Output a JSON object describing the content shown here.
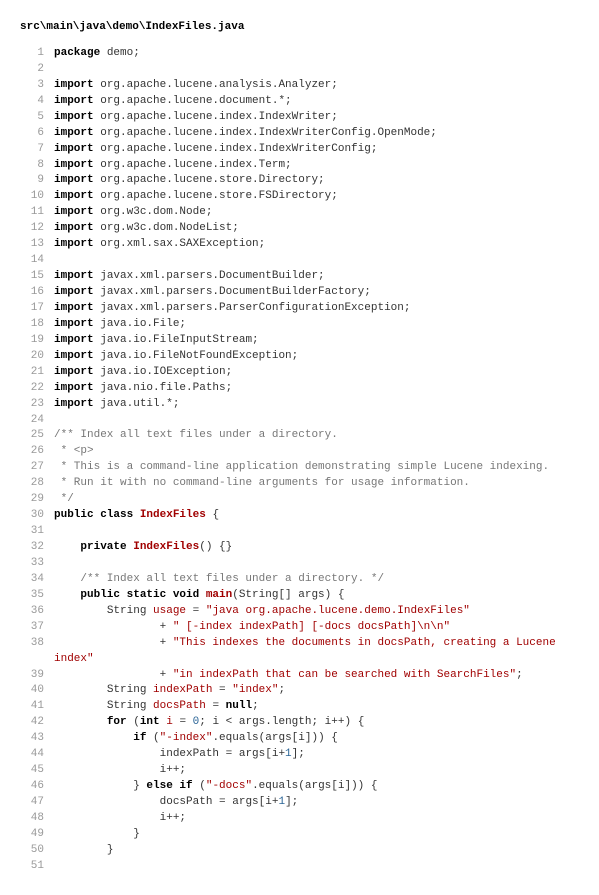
{
  "file_path": "src\\main\\java\\demo\\IndexFiles.java",
  "lines": [
    {
      "n": 1,
      "tokens": [
        {
          "t": "package ",
          "c": "kw"
        },
        {
          "t": "demo;",
          "c": ""
        }
      ]
    },
    {
      "n": 2,
      "tokens": []
    },
    {
      "n": 3,
      "tokens": [
        {
          "t": "import ",
          "c": "kw"
        },
        {
          "t": "org.apache.lucene.analysis.Analyzer;",
          "c": ""
        }
      ]
    },
    {
      "n": 4,
      "tokens": [
        {
          "t": "import ",
          "c": "kw"
        },
        {
          "t": "org.apache.lucene.document.*;",
          "c": ""
        }
      ]
    },
    {
      "n": 5,
      "tokens": [
        {
          "t": "import ",
          "c": "kw"
        },
        {
          "t": "org.apache.lucene.index.IndexWriter;",
          "c": ""
        }
      ]
    },
    {
      "n": 6,
      "tokens": [
        {
          "t": "import ",
          "c": "kw"
        },
        {
          "t": "org.apache.lucene.index.IndexWriterConfig.OpenMode;",
          "c": ""
        }
      ]
    },
    {
      "n": 7,
      "tokens": [
        {
          "t": "import ",
          "c": "kw"
        },
        {
          "t": "org.apache.lucene.index.IndexWriterConfig;",
          "c": ""
        }
      ]
    },
    {
      "n": 8,
      "tokens": [
        {
          "t": "import ",
          "c": "kw"
        },
        {
          "t": "org.apache.lucene.index.Term;",
          "c": ""
        }
      ]
    },
    {
      "n": 9,
      "tokens": [
        {
          "t": "import ",
          "c": "kw"
        },
        {
          "t": "org.apache.lucene.store.Directory;",
          "c": ""
        }
      ]
    },
    {
      "n": 10,
      "tokens": [
        {
          "t": "import ",
          "c": "kw"
        },
        {
          "t": "org.apache.lucene.store.FSDirectory;",
          "c": ""
        }
      ]
    },
    {
      "n": 11,
      "tokens": [
        {
          "t": "import ",
          "c": "kw"
        },
        {
          "t": "org.w3c.dom.Node;",
          "c": ""
        }
      ]
    },
    {
      "n": 12,
      "tokens": [
        {
          "t": "import ",
          "c": "kw"
        },
        {
          "t": "org.w3c.dom.NodeList;",
          "c": ""
        }
      ]
    },
    {
      "n": 13,
      "tokens": [
        {
          "t": "import ",
          "c": "kw"
        },
        {
          "t": "org.xml.sax.SAXException;",
          "c": ""
        }
      ]
    },
    {
      "n": 14,
      "tokens": []
    },
    {
      "n": 15,
      "tokens": [
        {
          "t": "import ",
          "c": "kw"
        },
        {
          "t": "javax.xml.parsers.DocumentBuilder;",
          "c": ""
        }
      ]
    },
    {
      "n": 16,
      "tokens": [
        {
          "t": "import ",
          "c": "kw"
        },
        {
          "t": "javax.xml.parsers.DocumentBuilderFactory;",
          "c": ""
        }
      ]
    },
    {
      "n": 17,
      "tokens": [
        {
          "t": "import ",
          "c": "kw"
        },
        {
          "t": "javax.xml.parsers.ParserConfigurationException;",
          "c": ""
        }
      ]
    },
    {
      "n": 18,
      "tokens": [
        {
          "t": "import ",
          "c": "kw"
        },
        {
          "t": "java.io.File;",
          "c": ""
        }
      ]
    },
    {
      "n": 19,
      "tokens": [
        {
          "t": "import ",
          "c": "kw"
        },
        {
          "t": "java.io.FileInputStream;",
          "c": ""
        }
      ]
    },
    {
      "n": 20,
      "tokens": [
        {
          "t": "import ",
          "c": "kw"
        },
        {
          "t": "java.io.FileNotFoundException;",
          "c": ""
        }
      ]
    },
    {
      "n": 21,
      "tokens": [
        {
          "t": "import ",
          "c": "kw"
        },
        {
          "t": "java.io.IOException;",
          "c": ""
        }
      ]
    },
    {
      "n": 22,
      "tokens": [
        {
          "t": "import ",
          "c": "kw"
        },
        {
          "t": "java.nio.file.Paths;",
          "c": ""
        }
      ]
    },
    {
      "n": 23,
      "tokens": [
        {
          "t": "import ",
          "c": "kw"
        },
        {
          "t": "java.util.*;",
          "c": ""
        }
      ]
    },
    {
      "n": 24,
      "tokens": []
    },
    {
      "n": 25,
      "tokens": [
        {
          "t": "/** Index all text files under a directory.",
          "c": "com"
        }
      ]
    },
    {
      "n": 26,
      "tokens": [
        {
          "t": " * <p>",
          "c": "com"
        }
      ]
    },
    {
      "n": 27,
      "tokens": [
        {
          "t": " * This is a command-line application demonstrating simple Lucene indexing.",
          "c": "com"
        }
      ]
    },
    {
      "n": 28,
      "tokens": [
        {
          "t": " * Run it with no command-line arguments for usage information.",
          "c": "com"
        }
      ]
    },
    {
      "n": 29,
      "tokens": [
        {
          "t": " */",
          "c": "com"
        }
      ]
    },
    {
      "n": 30,
      "tokens": [
        {
          "t": "public class ",
          "c": "kw"
        },
        {
          "t": "IndexFiles",
          "c": "cls"
        },
        {
          "t": " {",
          "c": ""
        }
      ]
    },
    {
      "n": 31,
      "tokens": []
    },
    {
      "n": 32,
      "tokens": [
        {
          "t": "    ",
          "c": ""
        },
        {
          "t": "private ",
          "c": "kw"
        },
        {
          "t": "IndexFiles",
          "c": "fn"
        },
        {
          "t": "() {}",
          "c": ""
        }
      ]
    },
    {
      "n": 33,
      "tokens": []
    },
    {
      "n": 34,
      "tokens": [
        {
          "t": "    ",
          "c": ""
        },
        {
          "t": "/** Index all text files under a directory. */",
          "c": "com"
        }
      ]
    },
    {
      "n": 35,
      "tokens": [
        {
          "t": "    ",
          "c": ""
        },
        {
          "t": "public static void ",
          "c": "kw"
        },
        {
          "t": "main",
          "c": "fn"
        },
        {
          "t": "(String[] args) {",
          "c": ""
        }
      ]
    },
    {
      "n": 36,
      "tokens": [
        {
          "t": "        String ",
          "c": ""
        },
        {
          "t": "usage",
          "c": "id"
        },
        {
          "t": " = ",
          "c": ""
        },
        {
          "t": "\"java org.apache.lucene.demo.IndexFiles\"",
          "c": "str"
        }
      ]
    },
    {
      "n": 37,
      "tokens": [
        {
          "t": "                + ",
          "c": ""
        },
        {
          "t": "\" [-index indexPath] [-docs docsPath]\\n\\n\"",
          "c": "str"
        }
      ]
    },
    {
      "n": 38,
      "tokens": [
        {
          "t": "                + ",
          "c": ""
        },
        {
          "t": "\"This indexes the documents in docsPath, creating a Lucene index\"",
          "c": "str"
        }
      ]
    },
    {
      "n": 39,
      "tokens": [
        {
          "t": "                + ",
          "c": ""
        },
        {
          "t": "\"in indexPath that can be searched with SearchFiles\"",
          "c": "str"
        },
        {
          "t": ";",
          "c": ""
        }
      ]
    },
    {
      "n": 40,
      "tokens": [
        {
          "t": "        String ",
          "c": ""
        },
        {
          "t": "indexPath",
          "c": "id"
        },
        {
          "t": " = ",
          "c": ""
        },
        {
          "t": "\"index\"",
          "c": "str"
        },
        {
          "t": ";",
          "c": ""
        }
      ]
    },
    {
      "n": 41,
      "tokens": [
        {
          "t": "        String ",
          "c": ""
        },
        {
          "t": "docsPath",
          "c": "id"
        },
        {
          "t": " = ",
          "c": ""
        },
        {
          "t": "null",
          "c": "lit"
        },
        {
          "t": ";",
          "c": ""
        }
      ]
    },
    {
      "n": 42,
      "tokens": [
        {
          "t": "        ",
          "c": ""
        },
        {
          "t": "for ",
          "c": "kw"
        },
        {
          "t": "(",
          "c": ""
        },
        {
          "t": "int ",
          "c": "kw"
        },
        {
          "t": "i",
          "c": "id"
        },
        {
          "t": " = ",
          "c": ""
        },
        {
          "t": "0",
          "c": "num"
        },
        {
          "t": "; i < args.length; i++) {",
          "c": ""
        }
      ]
    },
    {
      "n": 43,
      "tokens": [
        {
          "t": "            ",
          "c": ""
        },
        {
          "t": "if ",
          "c": "kw"
        },
        {
          "t": "(",
          "c": ""
        },
        {
          "t": "\"-index\"",
          "c": "str"
        },
        {
          "t": ".equals(args[i])) {",
          "c": ""
        }
      ]
    },
    {
      "n": 44,
      "tokens": [
        {
          "t": "                indexPath = args[i+",
          "c": ""
        },
        {
          "t": "1",
          "c": "num"
        },
        {
          "t": "];",
          "c": ""
        }
      ]
    },
    {
      "n": 45,
      "tokens": [
        {
          "t": "                i++;",
          "c": ""
        }
      ]
    },
    {
      "n": 46,
      "tokens": [
        {
          "t": "            } ",
          "c": ""
        },
        {
          "t": "else if ",
          "c": "kw"
        },
        {
          "t": "(",
          "c": ""
        },
        {
          "t": "\"-docs\"",
          "c": "str"
        },
        {
          "t": ".equals(args[i])) {",
          "c": ""
        }
      ]
    },
    {
      "n": 47,
      "tokens": [
        {
          "t": "                docsPath = args[i+",
          "c": ""
        },
        {
          "t": "1",
          "c": "num"
        },
        {
          "t": "];",
          "c": ""
        }
      ]
    },
    {
      "n": 48,
      "tokens": [
        {
          "t": "                i++;",
          "c": ""
        }
      ]
    },
    {
      "n": 49,
      "tokens": [
        {
          "t": "            }",
          "c": ""
        }
      ]
    },
    {
      "n": 50,
      "tokens": [
        {
          "t": "        }",
          "c": ""
        }
      ]
    },
    {
      "n": 51,
      "tokens": []
    }
  ]
}
